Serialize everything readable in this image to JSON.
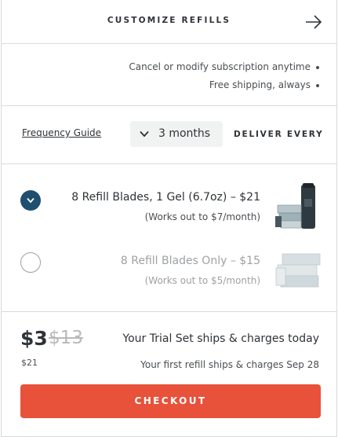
{
  "header": {
    "title": "CUSTOMIZE REFILLS",
    "forward_icon": "arrow-right-icon"
  },
  "benefits": [
    "Cancel or modify subscription anytime",
    "Free shipping, always"
  ],
  "frequency": {
    "label": "DELIVER EVERY",
    "selected": "3 months",
    "guide_link": "Frequency Guide"
  },
  "refill_options": [
    {
      "title": "8 Refill Blades, 1 Gel (6.7oz) – $21",
      "subtitle": "(Works out to $7/month)",
      "selected": true,
      "image": "blades-and-gel-can"
    },
    {
      "title": "8 Refill Blades Only – $15",
      "subtitle": "(Works out to $5/month)",
      "selected": false,
      "image": "blades-only"
    }
  ],
  "summary": {
    "line1": "Your Trial Set ships & charges today",
    "line2": "Your first refill ships & charges Sep 28",
    "price_new": "$3",
    "price_old": "$13",
    "price_refill": "$21",
    "checkout_label": "CHECKOUT"
  },
  "colors": {
    "accent": "#e8513a",
    "selected_radio": "#1f4f6e"
  }
}
